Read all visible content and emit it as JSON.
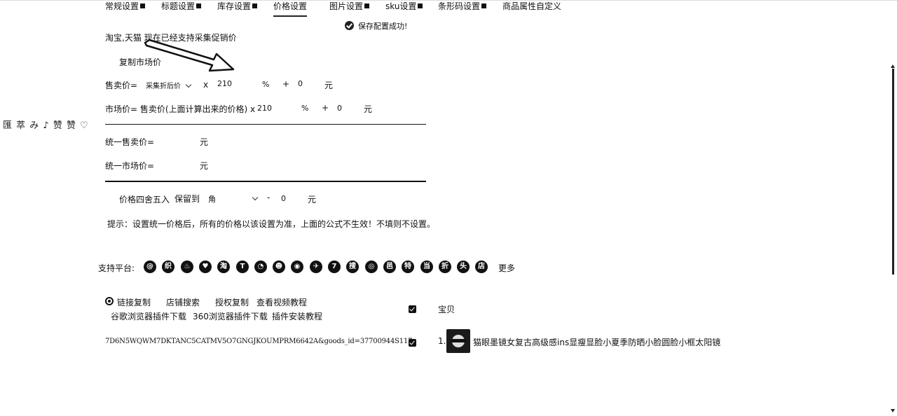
{
  "tabs": [
    {
      "label": "常规设置",
      "dropdown": true
    },
    {
      "label": "标题设置",
      "dropdown": true
    },
    {
      "label": "库存设置",
      "dropdown": true
    },
    {
      "label": "价格设置",
      "dropdown": false,
      "active": true
    },
    {
      "label": "图片设置",
      "dropdown": true
    },
    {
      "label": "sku设置",
      "dropdown": true
    },
    {
      "label": "条形码设置",
      "dropdown": true
    },
    {
      "label": "商品属性自定义",
      "dropdown": false
    }
  ],
  "save_status": "保存配置成功!",
  "price": {
    "notice": "淘宝,天猫 现在已经支持采集促销价",
    "copy_market_label": "复制市场价",
    "sell_price": {
      "label": "售卖价=",
      "source": "采集折后价",
      "mult": "x",
      "percent_value": "210",
      "percent": "%",
      "plus": "+",
      "add_value": "0",
      "unit": "元"
    },
    "market_price": {
      "label": "市场价= 售卖价(上面计算出来的价格) x",
      "percent_value": "210",
      "percent": "%",
      "plus": "+",
      "add_value": "0",
      "unit": "元"
    },
    "uniform_sell": {
      "label": "统一售卖价=",
      "unit": "元"
    },
    "uniform_market": {
      "label": "统一市场价=",
      "unit": "元"
    },
    "rounding": {
      "label": "价格四舍五入",
      "keep": "保留到",
      "unit_select": "角",
      "minus": "-",
      "value": "0",
      "unit": "元"
    },
    "tip": "提示：设置统一价格后，所有的价格以该设置为准，上面的公式不生效！不填则不设置。"
  },
  "platforms": {
    "label": "支持平台:",
    "icons": [
      {
        "name": "pinduoduo-icon",
        "glyph": "@"
      },
      {
        "name": "1688-icon",
        "glyph": "织"
      },
      {
        "name": "flame-icon",
        "glyph": "♨"
      },
      {
        "name": "vip-icon",
        "glyph": "♥"
      },
      {
        "name": "tmall-icon",
        "glyph": "淘"
      },
      {
        "name": "t-icon",
        "glyph": "T"
      },
      {
        "name": "cat-icon",
        "glyph": "◔"
      },
      {
        "name": "robot-icon",
        "glyph": "☻"
      },
      {
        "name": "eye-icon",
        "glyph": "◉"
      },
      {
        "name": "wing-icon",
        "glyph": "✈"
      },
      {
        "name": "seven-icon",
        "glyph": "7"
      },
      {
        "name": "sou-icon",
        "glyph": "搜"
      },
      {
        "name": "ring-icon",
        "glyph": "◎"
      },
      {
        "name": "lang-icon",
        "glyph": "邑"
      },
      {
        "name": "te-icon",
        "glyph": "特"
      },
      {
        "name": "dang-icon",
        "glyph": "当"
      },
      {
        "name": "zhe-icon",
        "glyph": "折"
      },
      {
        "name": "tou-icon",
        "glyph": "头"
      },
      {
        "name": "dian-icon",
        "glyph": "店"
      }
    ],
    "more": "更多"
  },
  "collect": {
    "links": [
      "链接复制",
      "店铺搜索",
      "授权复制",
      "查看视频教程"
    ],
    "plugins": [
      "谷歌浏览器插件下载",
      "360浏览器插件下载",
      "插件安装教程"
    ],
    "url_text": "7D6N5WQWM7DKTANC5CATMV5O7GNGJKOUMPRM6642A&goods_id=37700944S117",
    "header_label": "宝贝",
    "items": [
      {
        "index": "1.",
        "title": "猫眼墨镜女复古高级感ins显瘦显脸小夏季防晒小脸圆脸小框太阳镜"
      }
    ]
  },
  "side_widget": "匯 萃 み ♪ 赞 赞 ♡"
}
